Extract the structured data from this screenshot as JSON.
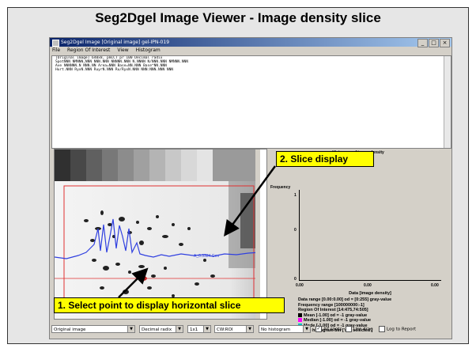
{
  "slide": {
    "title": "Seg2Dgel Image Viewer - Image density slice"
  },
  "window": {
    "title": "Seg2Dgel Image [Original image]  gel-IPN-019",
    "buttons": [
      "_",
      "□",
      "×"
    ],
    "menu": [
      "File",
      "Region Of Interest",
      "View",
      "Histogram"
    ]
  },
  "text_panel": {
    "lines": [
      "[Original image] 640x8, pmCCT pr 100 Decimal radix",
      "SpotNNN NMNNN,NNN NNN.NNN NNNNN.NNN N.NNNN N/NNN.NNN NMNNN.NNN",
      " Ave NNNNNN.N NNN.NN Area=NNN Base=NN.NNN Base^NN.NNN",
      " Hurt.NNN RyxN.NNN RuyrN.NNN Ru/RyxN.NNN NNN:NNN.NNN NNN"
    ]
  },
  "histogram": {
    "title": "Histogram of image density",
    "ylabel": "Frequency",
    "yticks": [
      "1",
      "0",
      "0"
    ],
    "xticks": [
      "0.00",
      "0.00",
      "0.00"
    ],
    "xlabel": "Data [image density]",
    "info": {
      "data_range": "Data range [0.00:0.00] od = [0:255] gray-value",
      "frequency_range": "Frequency range [100000000:-1]",
      "roi": "Region Of Interest [14:475,74:505]",
      "mean": "Mean [-1.00] od = -1 gray-value",
      "median": "Median [-1.00] od = -1 gray-value",
      "mode": "Mode [-1.00] od = -1 gray-value",
      "active_bin": "Active histogram bin ['not selected']"
    },
    "colors": {
      "mean": "#000000",
      "median": "#ff00ff",
      "mode": "#00c0c0"
    }
  },
  "image_panel": {
    "slice_label": "A_0.3324 Gen"
  },
  "bottom_bar": {
    "image_select": "Original image",
    "radix_select": "Decimal radix",
    "zoom_select": "1x1",
    "roi_select": "CW:ROI",
    "hist_select": "No histogram",
    "all_spots": "All spots",
    "use_drag": "Use drag",
    "log_report": "Log to Report",
    "arrow": "▼",
    "check_mark": "✓"
  },
  "callouts": {
    "slice_display": "2. Slice display",
    "select_point": "1. Select point to display horizontal slice"
  },
  "colors": {
    "slice_line": "#3040e0",
    "roi_line": "#e03030",
    "callout_bg": "#ffff00",
    "titlebar": "#0a246a"
  }
}
